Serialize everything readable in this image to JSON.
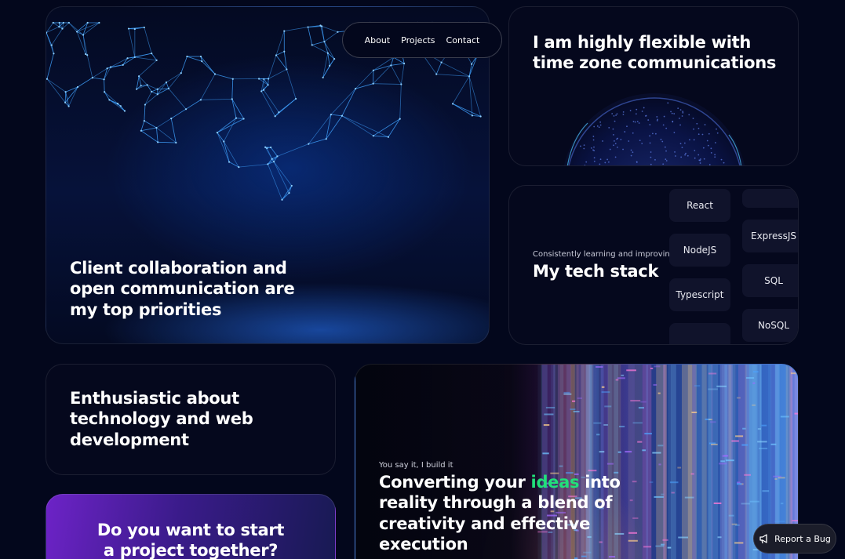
{
  "nav": {
    "items": [
      "About",
      "Projects",
      "Contact"
    ]
  },
  "collab_card": {
    "title": "Client collaboration and open communication are my top priorities"
  },
  "timezone_card": {
    "title": "I am highly flexible with time zone communications"
  },
  "stack_card": {
    "subtitle": "Consistently learning and improving",
    "title": "My tech stack",
    "column_left": [
      "React",
      "NodeJS",
      "Typescript",
      ""
    ],
    "column_right": [
      "",
      "ExpressJS",
      "SQL",
      "NoSQL"
    ]
  },
  "enth_card": {
    "title": "Enthusiastic about technology and web development"
  },
  "cta_card": {
    "title": "Do you want to start a project together?"
  },
  "ideas_card": {
    "subtitle": "You say it, I build it",
    "title_before": "Converting your ",
    "title_highlight": "ideas",
    "title_after": " into reality through a blend of creativity and effective execution"
  },
  "report_bug": {
    "label": "Report a Bug",
    "icon": "megaphone-icon"
  },
  "colors": {
    "background": "#03071c",
    "accent_green": "#21e07a",
    "cta_purple": "#6d23c7"
  }
}
